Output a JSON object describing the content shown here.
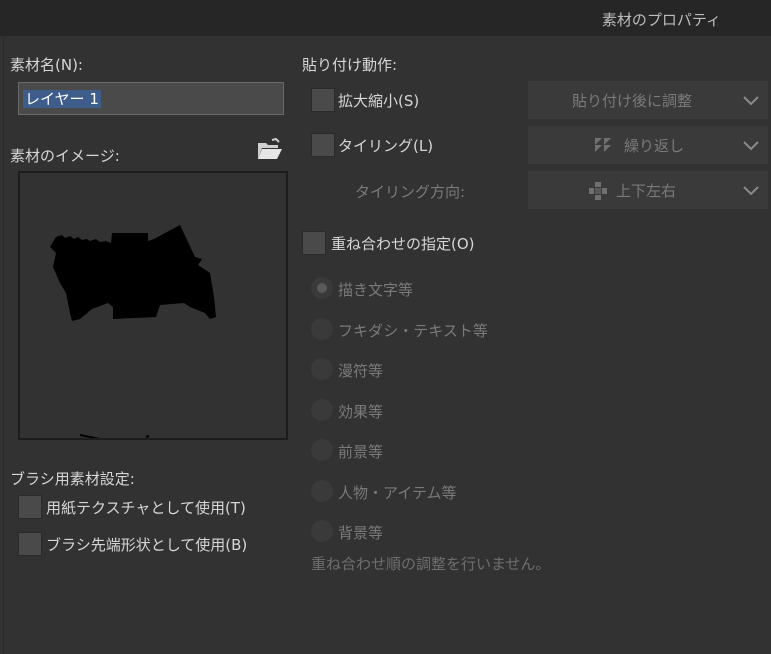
{
  "window": {
    "title": "素材のプロパティ"
  },
  "material_name": {
    "label": "素材名(N):",
    "value": "レイヤー 1"
  },
  "material_image": {
    "label": "素材のイメージ:",
    "folder_icon": "folder-open-icon"
  },
  "brush_settings": {
    "label": "ブラシ用素材設定:",
    "paper_texture": {
      "label": "用紙テクスチャとして使用(T)",
      "checked": false
    },
    "brush_tip": {
      "label": "ブラシ先端形状として使用(B)",
      "checked": false
    }
  },
  "paste": {
    "label": "貼り付け動作:",
    "scale": {
      "label": "拡大縮小(S)",
      "checked": false,
      "dropdown": "貼り付け後に調整"
    },
    "tiling": {
      "label": "タイリング(L)",
      "checked": false,
      "dropdown": "繰り返し",
      "dropdown_icon": "tile-repeat-icon"
    },
    "tiling_direction": {
      "label": "タイリング方向:",
      "dropdown": "上下左右",
      "dropdown_icon": "four-way-arrow-icon"
    }
  },
  "overlay": {
    "label": "重ね合わせの指定(O)",
    "checked": false,
    "options": [
      {
        "label": "描き文字等",
        "selected": true
      },
      {
        "label": "フキダシ・テキスト等",
        "selected": false
      },
      {
        "label": "漫符等",
        "selected": false
      },
      {
        "label": "効果等",
        "selected": false
      },
      {
        "label": "前景等",
        "selected": false
      },
      {
        "label": "人物・アイテム等",
        "selected": false
      },
      {
        "label": "背景等",
        "selected": false
      }
    ],
    "note": "重ね合わせ順の調整を行いません。"
  }
}
